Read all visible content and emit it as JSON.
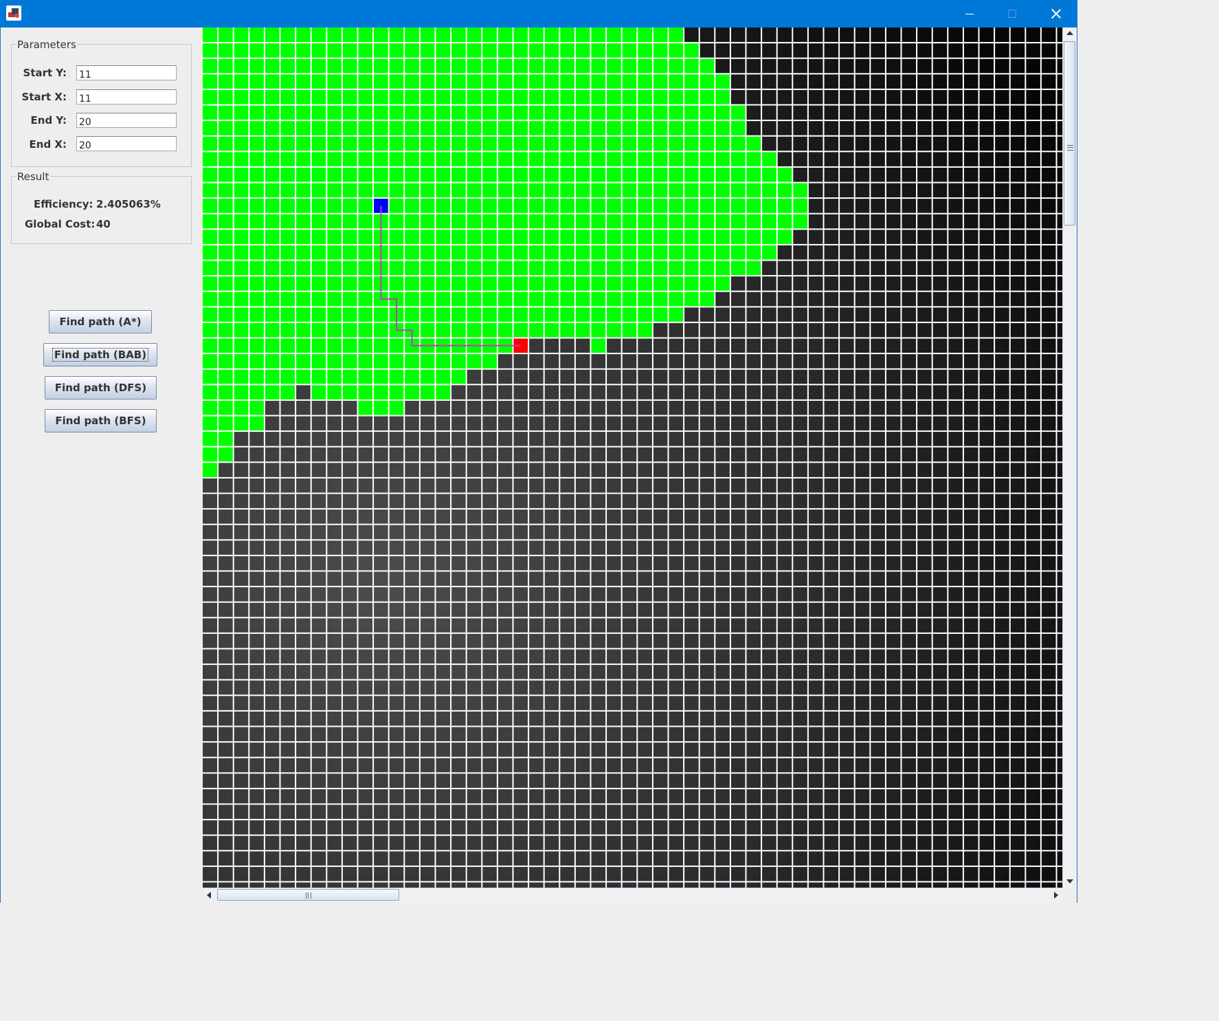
{
  "window": {
    "title": "",
    "icon": "java-app-icon",
    "controls": [
      "minimize-icon",
      "maximize-icon",
      "close-icon"
    ]
  },
  "parameters": {
    "title": "Parameters",
    "fields": [
      {
        "label": "Start Y:",
        "value": "11"
      },
      {
        "label": "Start X:",
        "value": "11"
      },
      {
        "label": "End Y:",
        "value": "20"
      },
      {
        "label": "End X:",
        "value": "20"
      }
    ]
  },
  "result": {
    "title": "Result",
    "efficiency_label": "Efficiency:",
    "efficiency_value": "2.405063%",
    "cost_label": "Global Cost:",
    "cost_value": "40"
  },
  "buttons": {
    "astar": "Find path (A*)",
    "bab": "Find path (BAB)",
    "dfs": "Find path (DFS)",
    "bfs": "Find path (BFS)"
  },
  "grid": {
    "colors": {
      "explored": "#00ff00",
      "start": "#0000ff",
      "end": "#ff0000",
      "path": "#cc33cc",
      "lines": "#ffffff"
    },
    "visible_rows": 56,
    "visible_cols": 56,
    "start_cell": {
      "row": 11,
      "col": 11
    },
    "end_cell": {
      "row": 20,
      "col": 20
    },
    "path_cells": [
      [
        11,
        11
      ],
      [
        12,
        11
      ],
      [
        13,
        11
      ],
      [
        14,
        11
      ],
      [
        15,
        11
      ],
      [
        16,
        11
      ],
      [
        17,
        11
      ],
      [
        17,
        12
      ],
      [
        18,
        12
      ],
      [
        19,
        12
      ],
      [
        19,
        13
      ],
      [
        20,
        13
      ],
      [
        20,
        14
      ],
      [
        20,
        15
      ],
      [
        20,
        16
      ],
      [
        20,
        17
      ],
      [
        20,
        18
      ],
      [
        20,
        19
      ],
      [
        20,
        20
      ]
    ],
    "explored_row_ranges": [
      [
        [
          0,
          30
        ]
      ],
      [
        [
          0,
          31
        ]
      ],
      [
        [
          0,
          32
        ]
      ],
      [
        [
          0,
          33
        ]
      ],
      [
        [
          0,
          33
        ]
      ],
      [
        [
          0,
          34
        ]
      ],
      [
        [
          0,
          34
        ]
      ],
      [
        [
          0,
          35
        ]
      ],
      [
        [
          0,
          36
        ]
      ],
      [
        [
          0,
          37
        ]
      ],
      [
        [
          0,
          38
        ]
      ],
      [
        [
          0,
          38
        ]
      ],
      [
        [
          0,
          38
        ]
      ],
      [
        [
          0,
          37
        ]
      ],
      [
        [
          0,
          36
        ]
      ],
      [
        [
          0,
          35
        ]
      ],
      [
        [
          0,
          33
        ]
      ],
      [
        [
          0,
          32
        ]
      ],
      [
        [
          0,
          30
        ]
      ],
      [
        [
          0,
          28
        ]
      ],
      [
        [
          0,
          19
        ],
        [
          25,
          25
        ]
      ],
      [
        [
          0,
          18
        ]
      ],
      [
        [
          0,
          16
        ]
      ],
      [
        [
          0,
          5
        ],
        [
          7,
          15
        ]
      ],
      [
        [
          0,
          3
        ],
        [
          10,
          12
        ]
      ],
      [
        [
          0,
          3
        ]
      ],
      [
        [
          0,
          1
        ]
      ],
      [
        [
          0,
          1
        ]
      ],
      [
        [
          0,
          0
        ]
      ]
    ]
  }
}
